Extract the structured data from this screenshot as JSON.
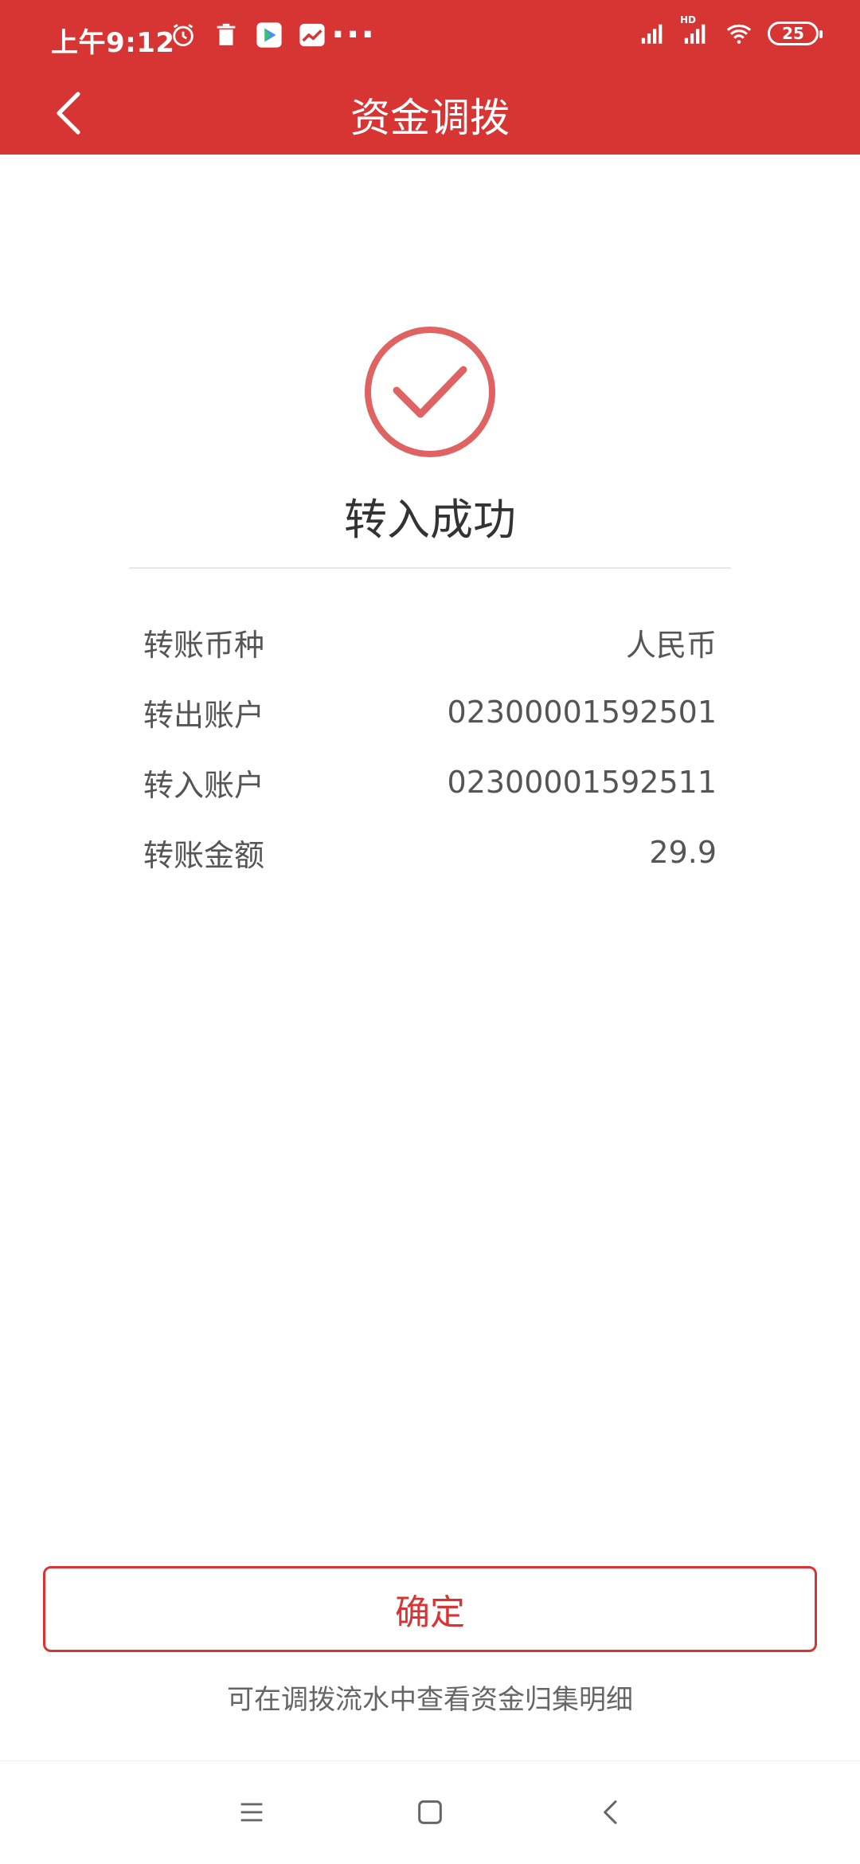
{
  "status_bar": {
    "time": "上午9:12",
    "battery": "25",
    "network_label": "HD"
  },
  "header": {
    "title": "资金调拨"
  },
  "result": {
    "title": "转入成功"
  },
  "details": [
    {
      "label": "转账币种",
      "value": "人民币"
    },
    {
      "label": "转出账户",
      "value": "02300001592501"
    },
    {
      "label": "转入账户",
      "value": "02300001592511"
    },
    {
      "label": "转账金额",
      "value": "29.9"
    }
  ],
  "actions": {
    "confirm_label": "确定",
    "hint": "可在调拨流水中查看资金归集明细"
  },
  "colors": {
    "accent": "#d73534",
    "success_icon": "#e06363",
    "text_primary": "#333333",
    "text_secondary": "#555555"
  },
  "icons": {
    "back": "chevron-left-icon",
    "success": "check-circle-icon",
    "nav_menu": "menu-icon",
    "nav_home": "square-icon",
    "nav_back": "chevron-left-icon"
  }
}
